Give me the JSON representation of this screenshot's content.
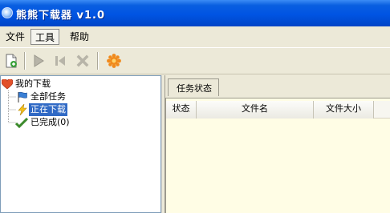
{
  "window": {
    "title": "熊熊下载器 v1.0"
  },
  "menu": {
    "items": [
      "文件",
      "工具",
      "帮助"
    ]
  },
  "toolbar": {
    "buttons": [
      {
        "icon": "new-task-icon",
        "enabled": true
      },
      {
        "icon": "play-icon",
        "enabled": false
      },
      {
        "icon": "stop-icon",
        "enabled": false
      },
      {
        "icon": "delete-icon",
        "enabled": false
      },
      {
        "icon": "settings-icon",
        "enabled": true
      }
    ]
  },
  "tree": {
    "root": {
      "label": "我的下载",
      "icon": "heart-icon"
    },
    "children": [
      {
        "label": "全部任务",
        "icon": "flag-icon"
      },
      {
        "label": "正在下载",
        "icon": "lightning-icon",
        "selected": true
      },
      {
        "label": "已完成(0)",
        "icon": "checkmark-icon"
      }
    ]
  },
  "tabs": {
    "active_label": "任务状态"
  },
  "table": {
    "columns": [
      "状态",
      "文件名",
      "文件大小"
    ]
  },
  "colors": {
    "titlebar": "#0054e3",
    "selection": "#316ac5",
    "list_bg": "#fffde5"
  }
}
